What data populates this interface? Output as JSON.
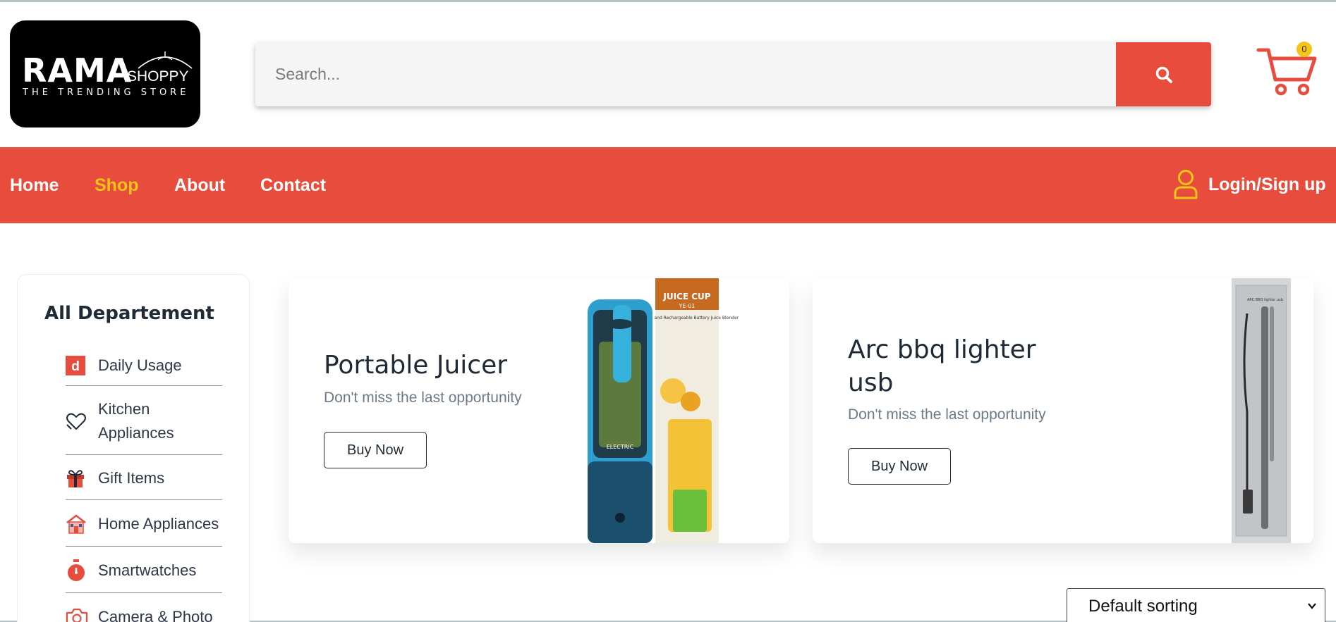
{
  "logo": {
    "brand_main": "RAMA",
    "brand_sub": "SHOPPY",
    "tagline": "THE TRENDING STORE"
  },
  "search": {
    "placeholder": "Search...",
    "value": ""
  },
  "cart": {
    "count": "0"
  },
  "nav": {
    "items": [
      {
        "label": "Home"
      },
      {
        "label": "Shop"
      },
      {
        "label": "About"
      },
      {
        "label": "Contact"
      }
    ],
    "login_label": "Login/Sign up"
  },
  "sidebar": {
    "title": "All Departement",
    "items": [
      {
        "label": "Daily Usage",
        "icon": "daily-usage-icon"
      },
      {
        "label": "Kitchen Appliances",
        "icon": "heart-hand-icon"
      },
      {
        "label": "Gift Items",
        "icon": "gift-icon"
      },
      {
        "label": "Home Appliances",
        "icon": "house-icon"
      },
      {
        "label": "Smartwatches",
        "icon": "stopwatch-icon"
      },
      {
        "label": "Camera & Photo",
        "icon": "camera-icon"
      }
    ]
  },
  "banners": [
    {
      "title": "Portable Juicer",
      "subtitle": "Don't miss the last opportunity",
      "button": "Buy Now",
      "box_text": "JUICE CUP",
      "box_model": "YE-01",
      "box_desc": "Portable and Rechargeable Battery Juice Blender",
      "bottle_text": "ELECTRIC"
    },
    {
      "title": "Arc bbq lighter usb",
      "subtitle": "Don't miss the last opportunity",
      "button": "Buy Now",
      "pack_text": "ARC BBQ lighter usb"
    }
  ],
  "sorting": {
    "selected": "Default sorting"
  },
  "colors": {
    "brand": "#e74c3c",
    "accent": "#f5c518",
    "text_dark": "#1f2a37",
    "text_muted": "#6b7a8a"
  }
}
